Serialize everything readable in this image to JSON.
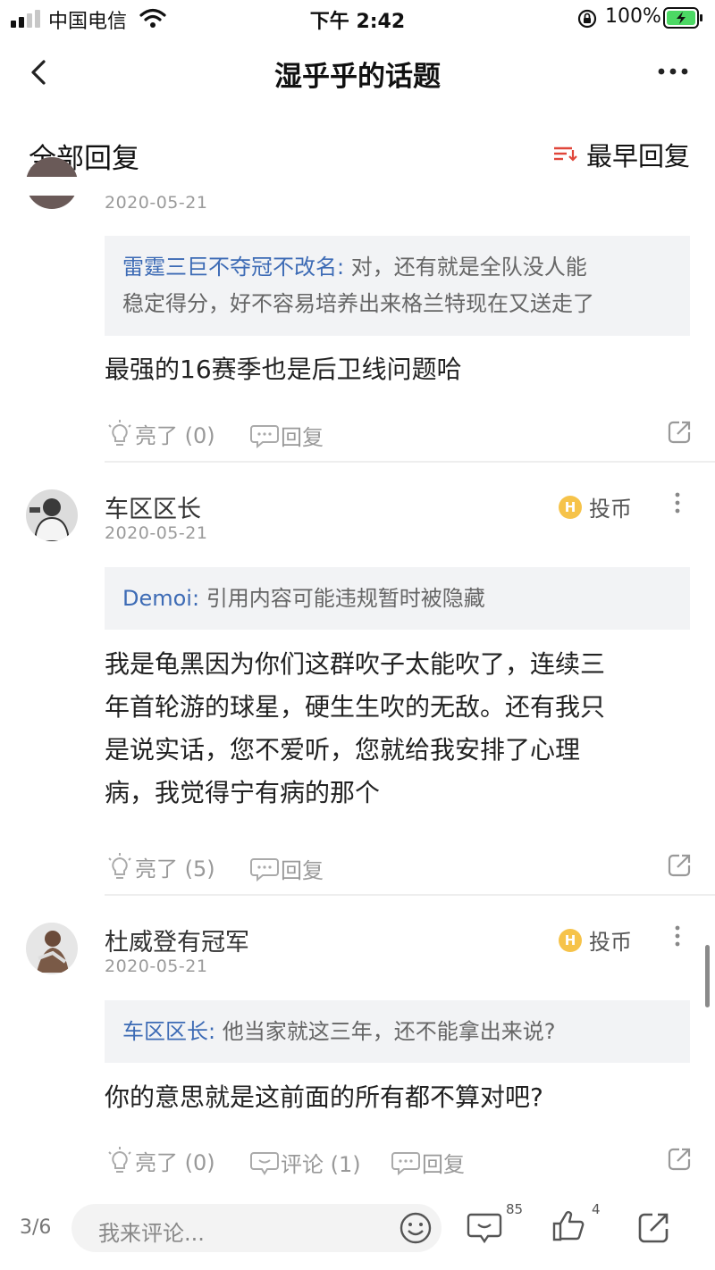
{
  "status_bar": {
    "carrier": "中国电信",
    "time": "下午 2:42",
    "battery": "100%"
  },
  "nav": {
    "title": "湿乎乎的话题"
  },
  "filter": {
    "label": "全部回复",
    "sort_label": "最早回复"
  },
  "posts": [
    {
      "date": "2020-05-21",
      "quote_author": "雷霆三巨不夺冠不改名:",
      "quote_line1": " 对，还有就是全队没人能",
      "quote_line2": "稳定得分，好不容易培养出来格兰特现在又送走了",
      "body": [
        "最强的16赛季也是后卫线问题哈"
      ],
      "light_label": "亮了 (0)",
      "reply_label": "回复"
    },
    {
      "username": "车区区长",
      "date": "2020-05-21",
      "coin_label": "投币",
      "quote_author": "Demoi:",
      "quote_line1": " 引用内容可能违规暂时被隐藏",
      "body": [
        "我是龟黑因为你们这群吹子太能吹了，连续三",
        "年首轮游的球星，硬生生吹的无敌。还有我只",
        "是说实话，您不爱听，您就给我安排了心理",
        "病，我觉得宁有病的那个"
      ],
      "light_label": "亮了 (5)",
      "reply_label": "回复"
    },
    {
      "username": "杜威登有冠军",
      "date": "2020-05-21",
      "coin_label": "投币",
      "quote_author": "车区区长:",
      "quote_line1": " 他当家就这三年，还不能拿出来说?",
      "body": [
        "你的意思就是这前面的所有都不算对吧?"
      ],
      "light_label": "亮了 (0)",
      "comment_label": "评论 (1)",
      "reply_label": "回复"
    }
  ],
  "bottom_bar": {
    "page_indicator": "3/6",
    "comment_placeholder": "我来评论...",
    "comments_count": "85",
    "likes_count": "4"
  },
  "colors": {
    "accent_link": "#3d6bb5",
    "sort_icon": "#e0463a",
    "coin": "#f6c34a",
    "battery": "#4cd964"
  }
}
